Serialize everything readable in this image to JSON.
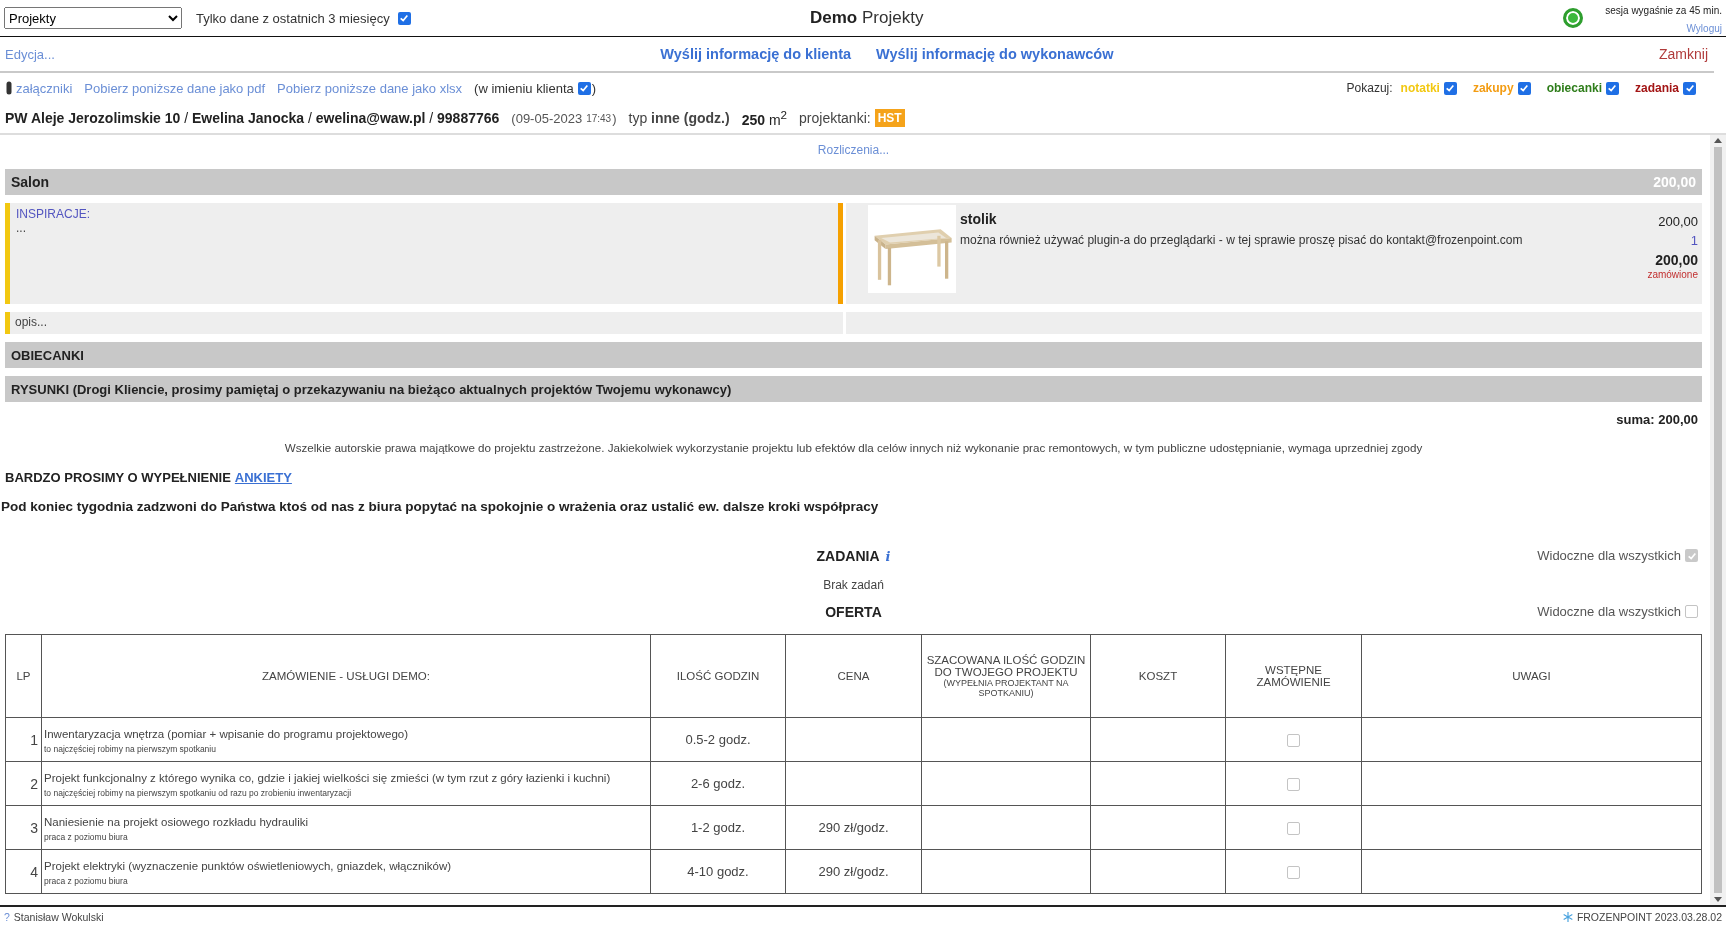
{
  "header": {
    "project_select": "Projekty",
    "recent_filter": {
      "label": "Tylko dane z ostatnich 3 miesięcy",
      "checked": true
    },
    "title_bold": "Demo",
    "title": "Projekty",
    "session_online": true,
    "session_note": "sesja wygaśnie za 45 min.",
    "logout": "Wyloguj"
  },
  "actions": {
    "edit": "Edycja...",
    "links": [
      "Wyślij informację do klienta",
      "Wyślij informację do wykonawców"
    ],
    "close": "Zamknij"
  },
  "tools": {
    "attachments": "załączniki",
    "links": [
      "Pobierz poniższe dane jako pdf",
      "Pobierz poniższe dane jako xlsx"
    ],
    "on_behalf": {
      "label": "(w imieniu klienta",
      "checked": true,
      "suffix": ")"
    },
    "show_label": "Pokazuj:",
    "filters": [
      {
        "label": "notatki",
        "color": "#f2c811",
        "checked": true
      },
      {
        "label": "zakupy",
        "color": "#f39c12",
        "checked": true
      },
      {
        "label": "obiecanki",
        "color": "#2e7d1a",
        "checked": true
      },
      {
        "label": "zadania",
        "color": "#a31515",
        "checked": true
      }
    ]
  },
  "client": {
    "details": "**PW Aleje Jerozolimskie 10** / **Ewelina Janocka** / **ewelina@waw.pl** / **99887766**",
    "date": "(09-05-2023",
    "time": "17:43",
    "date_end": ")",
    "type": "typ **inne (godz.)**",
    "area": "**250** m$^{2}$",
    "designers_label": "projektanki:",
    "designer_badge": "HST"
  },
  "billing": "Rozliczenia...",
  "room": {
    "name": "Salon",
    "total": "200,00",
    "inspiration_label": "INSPIRACJE:",
    "inspiration_text": "...",
    "item": {
      "kind": "picture",
      "name": "stolik",
      "note": "można również używać plugin-a do przeglądarki - w tej sprawie proszę pisać do kontakt@frozenpoint.com",
      "price": "200,00",
      "qty": "1",
      "sum": "200,00",
      "status": "zamówione"
    },
    "description": "opis..."
  },
  "sections": [
    "OBIECANKI",
    "RYSUNKI (Drogi Kliencie, prosimy pamiętaj o przekazywaniu na bieżąco aktualnych projektów Twojemu wykonawcy)"
  ],
  "sum": "suma: 200,00",
  "copyright": "Wszelkie autorskie prawa majątkowe do projektu zastrzeżone. Jakiekolwiek wykorzystanie projektu lub efektów dla celów innych niż wykonanie prac remontowych, w tym publiczne udostępnianie, wymaga uprzedniej zgody",
  "survey": {
    "text": "BARDZO PROSIMY O WYPEŁNIENIE",
    "link": "ANKIETY"
  },
  "call_note": "Pod koniec tygodnia zadzwoni do Państwa ktoś od nas z biura popytać na spokojnie o wrażenia oraz ustalić ew. dalsze kroki współpracy",
  "tasks": {
    "title": "ZADANIA",
    "info": "i",
    "visible_label": "Widoczne dla wszystkich",
    "visible": true,
    "empty": "Brak zadań"
  },
  "offer": {
    "title": "OFERTA",
    "visible_label": "Widoczne dla wszystkich",
    "visible": false,
    "columns": [
      {
        "label": "LP"
      },
      {
        "label": "ZAMÓWIENIE - USŁUGI DEMO:"
      },
      {
        "label": "ILOŚĆ GODZIN"
      },
      {
        "label": "CENA"
      },
      {
        "label": "SZACOWANA ILOŚĆ GODZIN DO TWOJEGO PROJEKTU",
        "sub": "(WYPEŁNIA PROJEKTANT NA SPOTKANIU)"
      },
      {
        "label": "KOSZT"
      },
      {
        "label": "WSTĘPNE ZAMÓWIENIE"
      },
      {
        "label": "UWAGI"
      }
    ],
    "rows": [
      {
        "lp": "1",
        "title": "Inwentaryzacja wnętrza (pomiar + wpisanie do programu projektowego)",
        "note": "to najczęściej robimy na pierwszym spotkaniu",
        "hours": "0.5-2 godz.",
        "ordered": false
      },
      {
        "lp": "2",
        "title": "Projekt funkcjonalny z którego wynika co, gdzie i jakiej wielkości się zmieści (w tym rzut z góry łazienki i kuchni)",
        "note": "to najczęściej robimy na pierwszym spotkaniu od razu po zrobieniu inwentaryzacji",
        "hours": "2-6 godz.",
        "ordered": false
      },
      {
        "lp": "3",
        "title": "Naniesienie na projekt osiowego rozkładu hydrauliki",
        "note": "praca z poziomu biura",
        "hours": "1-2 godz.",
        "price": "290 zł/godz.",
        "ordered": false
      },
      {
        "lp": "4",
        "title": "Projekt elektryki (wyznaczenie punktów oświetleniowych, gniazdek, włączników)",
        "note": "praca z poziomu biura",
        "hours": "4-10 godz.",
        "price": "290 zł/godz.",
        "ordered": false
      }
    ]
  },
  "footer": {
    "help": "?",
    "user": "Stanisław Wokulski",
    "version": "FROZENPOINT 2023.03.28.02"
  }
}
